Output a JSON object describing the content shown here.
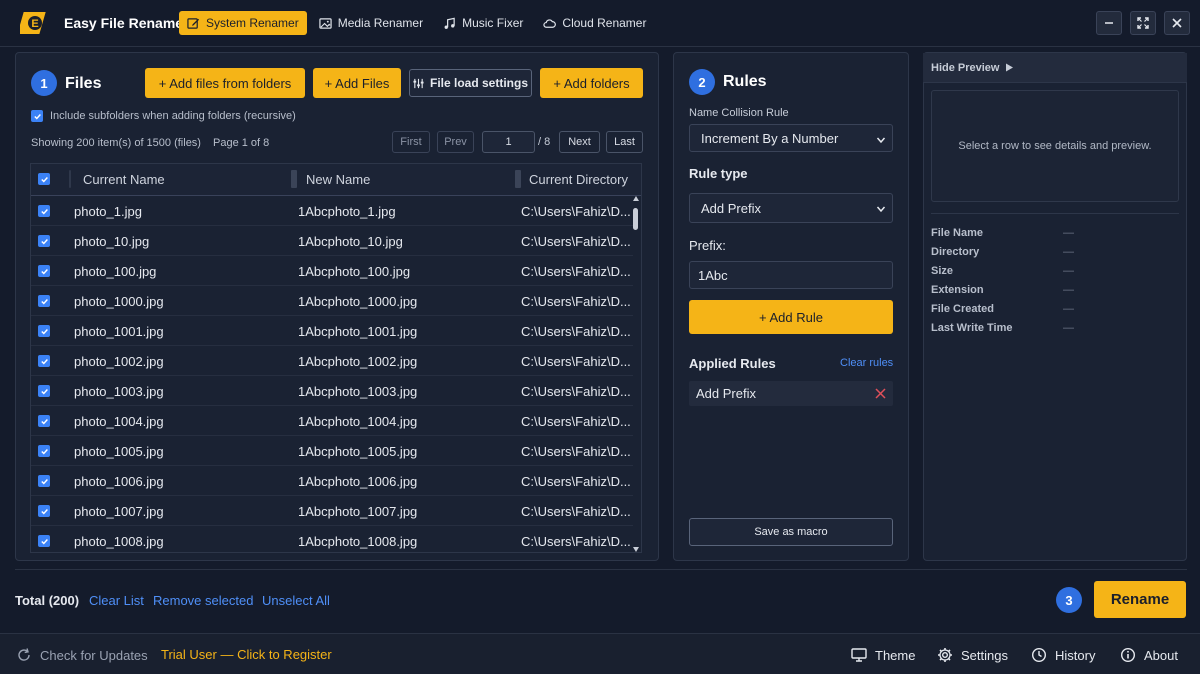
{
  "app": {
    "title": "Easy File Renamer"
  },
  "nav": [
    {
      "label": "System Renamer",
      "icon": "edit-icon"
    },
    {
      "label": "Media Renamer",
      "icon": "image-icon"
    },
    {
      "label": "Music Fixer",
      "icon": "music-icon"
    },
    {
      "label": "Cloud Renamer",
      "icon": "cloud-icon"
    }
  ],
  "files": {
    "step": "1",
    "title": "Files",
    "add_from_folders": "+ Add files from folders",
    "add_files": "+ Add Files",
    "load_settings": "File load settings",
    "add_folders": "+ Add folders",
    "include_subfolders": "Include subfolders when adding folders (recursive)",
    "showing": "Showing 200 item(s) of 1500 (files)",
    "page": "Page 1 of 8",
    "pager": {
      "first": "First",
      "prev": "Prev",
      "page_value": "1",
      "of": "/ 8",
      "next": "Next",
      "last": "Last"
    },
    "columns": [
      "Current Name",
      "New Name",
      "Current Directory"
    ],
    "rows": [
      {
        "current": "photo_1.jpg",
        "new": "1Abcphoto_1.jpg",
        "dir": "C:\\Users\\Fahiz\\D..."
      },
      {
        "current": "photo_10.jpg",
        "new": "1Abcphoto_10.jpg",
        "dir": "C:\\Users\\Fahiz\\D..."
      },
      {
        "current": "photo_100.jpg",
        "new": "1Abcphoto_100.jpg",
        "dir": "C:\\Users\\Fahiz\\D..."
      },
      {
        "current": "photo_1000.jpg",
        "new": "1Abcphoto_1000.jpg",
        "dir": "C:\\Users\\Fahiz\\D..."
      },
      {
        "current": "photo_1001.jpg",
        "new": "1Abcphoto_1001.jpg",
        "dir": "C:\\Users\\Fahiz\\D..."
      },
      {
        "current": "photo_1002.jpg",
        "new": "1Abcphoto_1002.jpg",
        "dir": "C:\\Users\\Fahiz\\D..."
      },
      {
        "current": "photo_1003.jpg",
        "new": "1Abcphoto_1003.jpg",
        "dir": "C:\\Users\\Fahiz\\D..."
      },
      {
        "current": "photo_1004.jpg",
        "new": "1Abcphoto_1004.jpg",
        "dir": "C:\\Users\\Fahiz\\D..."
      },
      {
        "current": "photo_1005.jpg",
        "new": "1Abcphoto_1005.jpg",
        "dir": "C:\\Users\\Fahiz\\D..."
      },
      {
        "current": "photo_1006.jpg",
        "new": "1Abcphoto_1006.jpg",
        "dir": "C:\\Users\\Fahiz\\D..."
      },
      {
        "current": "photo_1007.jpg",
        "new": "1Abcphoto_1007.jpg",
        "dir": "C:\\Users\\Fahiz\\D..."
      },
      {
        "current": "photo_1008.jpg",
        "new": "1Abcphoto_1008.jpg",
        "dir": "C:\\Users\\Fahiz\\D..."
      }
    ]
  },
  "rules": {
    "step": "2",
    "title": "Rules",
    "collision_label": "Name Collision Rule",
    "collision_value": "Increment By a Number",
    "rule_type_label": "Rule type",
    "rule_type_value": "Add Prefix",
    "prefix_label": "Prefix:",
    "prefix_value": "1Abc",
    "add_rule": "+ Add Rule",
    "applied_label": "Applied Rules",
    "clear_rules": "Clear rules",
    "applied": [
      "Add Prefix"
    ],
    "save_macro": "Save as macro"
  },
  "preview": {
    "hide": "Hide Preview",
    "placeholder": "Select a row to see details and preview.",
    "fields": [
      {
        "label": "File Name",
        "value": "—"
      },
      {
        "label": "Directory",
        "value": "—"
      },
      {
        "label": "Size",
        "value": "—"
      },
      {
        "label": "Extension",
        "value": "—"
      },
      {
        "label": "File Created",
        "value": "—"
      },
      {
        "label": "Last Write Time",
        "value": "—"
      }
    ]
  },
  "footer": {
    "total": "Total (200)",
    "clear_list": "Clear List",
    "remove_selected": "Remove selected",
    "unselect_all": "Unselect All",
    "step": "3",
    "rename": "Rename"
  },
  "statusbar": {
    "check_updates": "Check for Updates",
    "trial": "Trial User — Click to Register",
    "theme": "Theme",
    "settings": "Settings",
    "history": "History",
    "about": "About"
  },
  "colors": {
    "accent": "#f5b417",
    "link": "#4f8ff7",
    "step": "#2f6fe0",
    "background": "#141b2b"
  }
}
